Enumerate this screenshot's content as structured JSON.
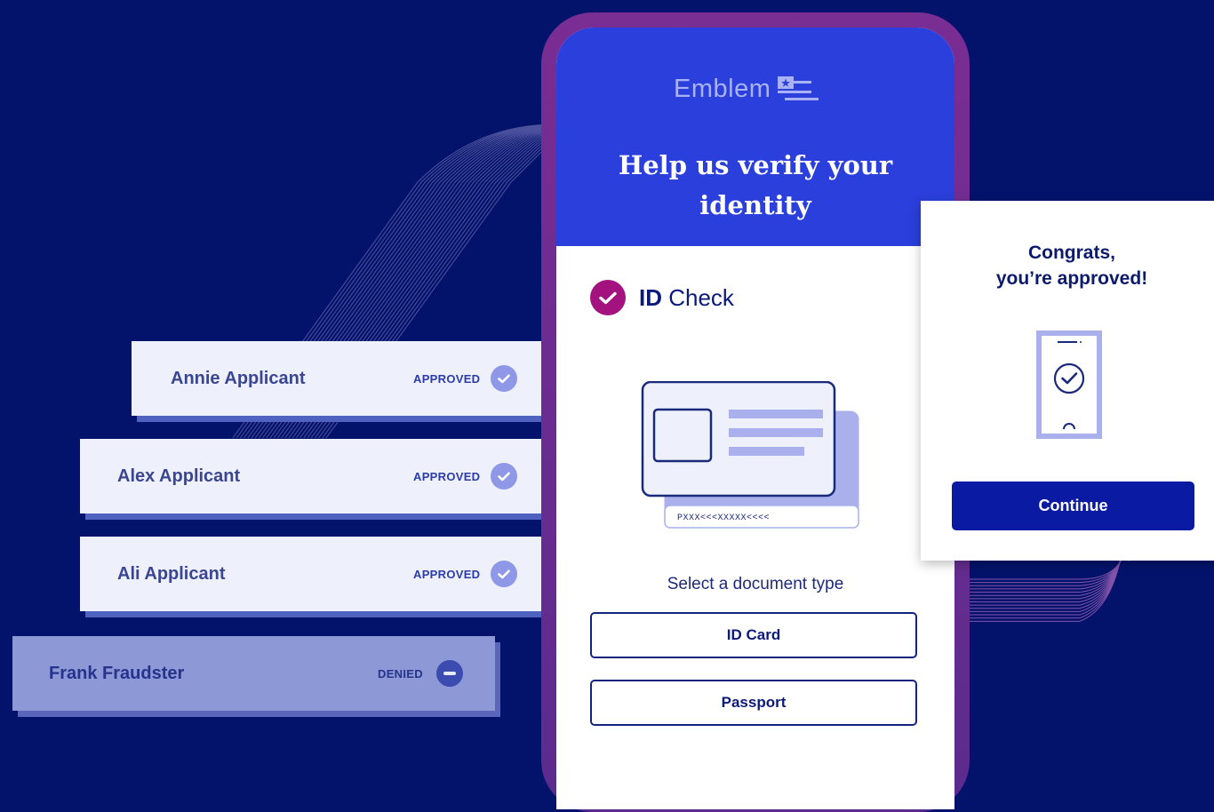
{
  "colors": {
    "background": "#03136b",
    "phone_header": "#2a3fdb",
    "accent_magenta": "#a3127f",
    "continue_button": "#0a1aa3"
  },
  "applicants": [
    {
      "name": "Annie Applicant",
      "status": "APPROVED",
      "status_icon": "check-icon"
    },
    {
      "name": "Alex Applicant",
      "status": "APPROVED",
      "status_icon": "check-icon"
    },
    {
      "name": "Ali Applicant",
      "status": "APPROVED",
      "status_icon": "check-icon"
    },
    {
      "name": "Frank Fraudster",
      "status": "DENIED",
      "status_icon": "minus-icon"
    }
  ],
  "phone": {
    "logo_text": "Emblem",
    "logo_icon": "flag-star-icon",
    "headline_line1": "Help us verify your",
    "headline_line2": "identity",
    "id_check_bold": "ID",
    "id_check_rest": " Check",
    "card_mrz": "PXXX<<<XXXXX<<<<",
    "select_label": "Select a document type",
    "document_types": [
      "ID Card",
      "Passport"
    ]
  },
  "congrats": {
    "title_line1": "Congrats,",
    "title_line2": "you’re approved!",
    "icon": "phone-check-icon",
    "continue_label": "Continue"
  }
}
